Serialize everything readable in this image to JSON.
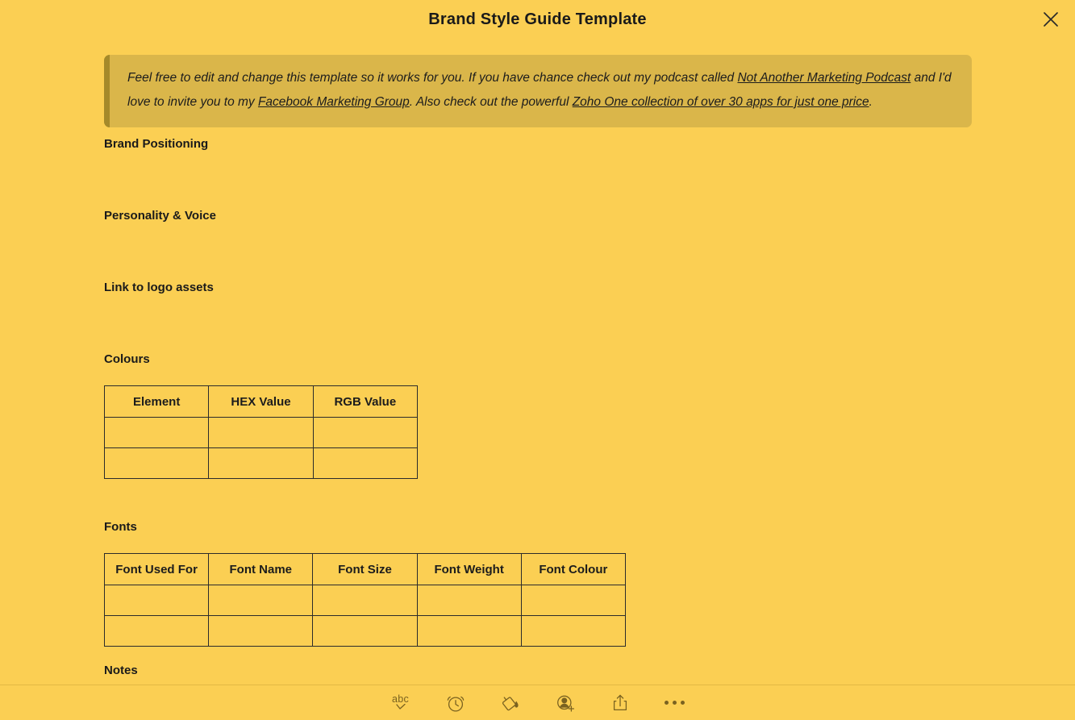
{
  "window": {
    "title": "Brand Style Guide Template",
    "close_label": "×",
    "close_icon": "close-icon",
    "background_color": "#fbcf53"
  },
  "callout": {
    "background_color": "#dab64a",
    "border_color": "#a58a2a",
    "line1_pre": "Feel free to edit and change this template so it works for you. If you have chance check out my podcast called ",
    "link1": "Not Another Marketing Podcast",
    "line1_post": " and I'd love to invite you to my ",
    "link2": "Facebook Marketing Group",
    "line2_mid": ". Also check out the powerful ",
    "link3": "Zoho One collection of over 30 apps for just one price",
    "line2_end": "."
  },
  "sections": {
    "brand_positioning": "Brand Positioning",
    "personality_voice": "Personality & Voice",
    "logo_assets": "Link to logo assets",
    "colours": "Colours",
    "fonts": "Fonts",
    "notes": "Notes"
  },
  "colours_table": {
    "headers": [
      "Element",
      "HEX Value",
      "RGB Value"
    ],
    "rows": [
      [
        "",
        "",
        ""
      ],
      [
        "",
        "",
        ""
      ]
    ]
  },
  "fonts_table": {
    "headers": [
      "Font Used For",
      "Font Name",
      "Font Size",
      "Font Weight",
      "Font Colour"
    ],
    "rows": [
      [
        "",
        "",
        "",
        "",
        ""
      ],
      [
        "",
        "",
        "",
        "",
        ""
      ]
    ]
  },
  "toolbar": {
    "spellcheck_label": "abc",
    "items": [
      {
        "name": "spellcheck-icon",
        "label": "abc"
      },
      {
        "name": "alarm-clock-icon",
        "label": ""
      },
      {
        "name": "paint-bucket-icon",
        "label": ""
      },
      {
        "name": "add-person-icon",
        "label": ""
      },
      {
        "name": "share-icon",
        "label": ""
      },
      {
        "name": "more-options-icon",
        "label": ""
      }
    ]
  }
}
